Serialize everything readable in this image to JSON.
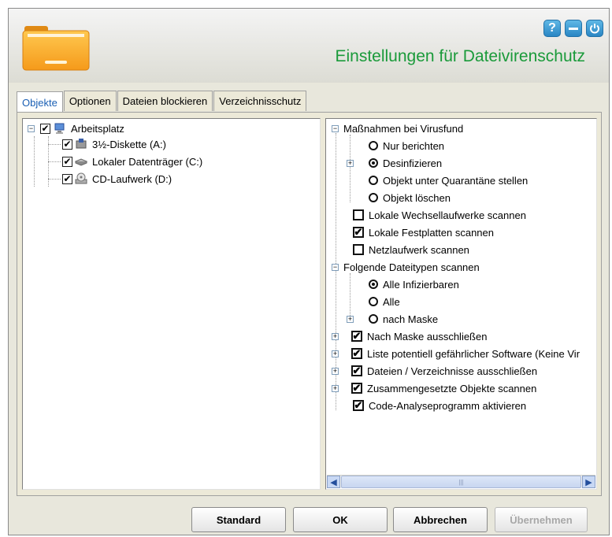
{
  "header": {
    "title": "Einstellungen für Dateivirenschutz",
    "buttons": {
      "help": "?",
      "minimize": "",
      "power": ""
    }
  },
  "tabs": [
    {
      "label": "Objekte",
      "active": true
    },
    {
      "label": "Optionen",
      "active": false
    },
    {
      "label": "Dateien blockieren",
      "active": false
    },
    {
      "label": "Verzeichnisschutz",
      "active": false
    }
  ],
  "left_tree": {
    "root": {
      "label": "Arbeitsplatz",
      "checked": true,
      "icon": "computer-icon"
    },
    "children": [
      {
        "label": "3½-Diskette (A:)",
        "checked": true,
        "icon": "floppy-drive-icon"
      },
      {
        "label": "Lokaler Datenträger (C:)",
        "checked": true,
        "icon": "hard-disk-icon"
      },
      {
        "label": "CD-Laufwerk (D:)",
        "checked": true,
        "icon": "cd-drive-icon"
      }
    ]
  },
  "right_tree": {
    "group1": "Maßnahmen bei Virusfund",
    "actions": [
      {
        "label": "Nur berichten",
        "selected": false
      },
      {
        "label": "Desinfizieren",
        "selected": true
      },
      {
        "label": "Objekt unter Quarantäne stellen",
        "selected": false
      },
      {
        "label": "Objekt löschen",
        "selected": false
      }
    ],
    "drive_options": [
      {
        "label": "Lokale Wechsellaufwerke scannen",
        "checked": false
      },
      {
        "label": "Lokale Festplatten scannen",
        "checked": true
      },
      {
        "label": "Netzlaufwerk scannen",
        "checked": false
      }
    ],
    "group2": "Folgende Dateitypen scannen",
    "file_types": [
      {
        "label": "Alle Infizierbaren",
        "selected": true
      },
      {
        "label": "Alle",
        "selected": false
      },
      {
        "label": "nach Maske",
        "selected": false
      }
    ],
    "extra_options": [
      {
        "label": "Nach Maske ausschließen",
        "checked": true
      },
      {
        "label": "Liste potentiell gefährlicher Software (Keine Vir",
        "checked": true
      },
      {
        "label": "Dateien / Verzeichnisse ausschließen",
        "checked": true
      },
      {
        "label": "Zusammengesetzte Objekte scannen",
        "checked": true
      },
      {
        "label": "Code-Analyseprogramm aktivieren",
        "checked": true
      }
    ]
  },
  "footer": {
    "standard": "Standard",
    "ok": "OK",
    "cancel": "Abbrechen",
    "apply": "Übernehmen"
  }
}
